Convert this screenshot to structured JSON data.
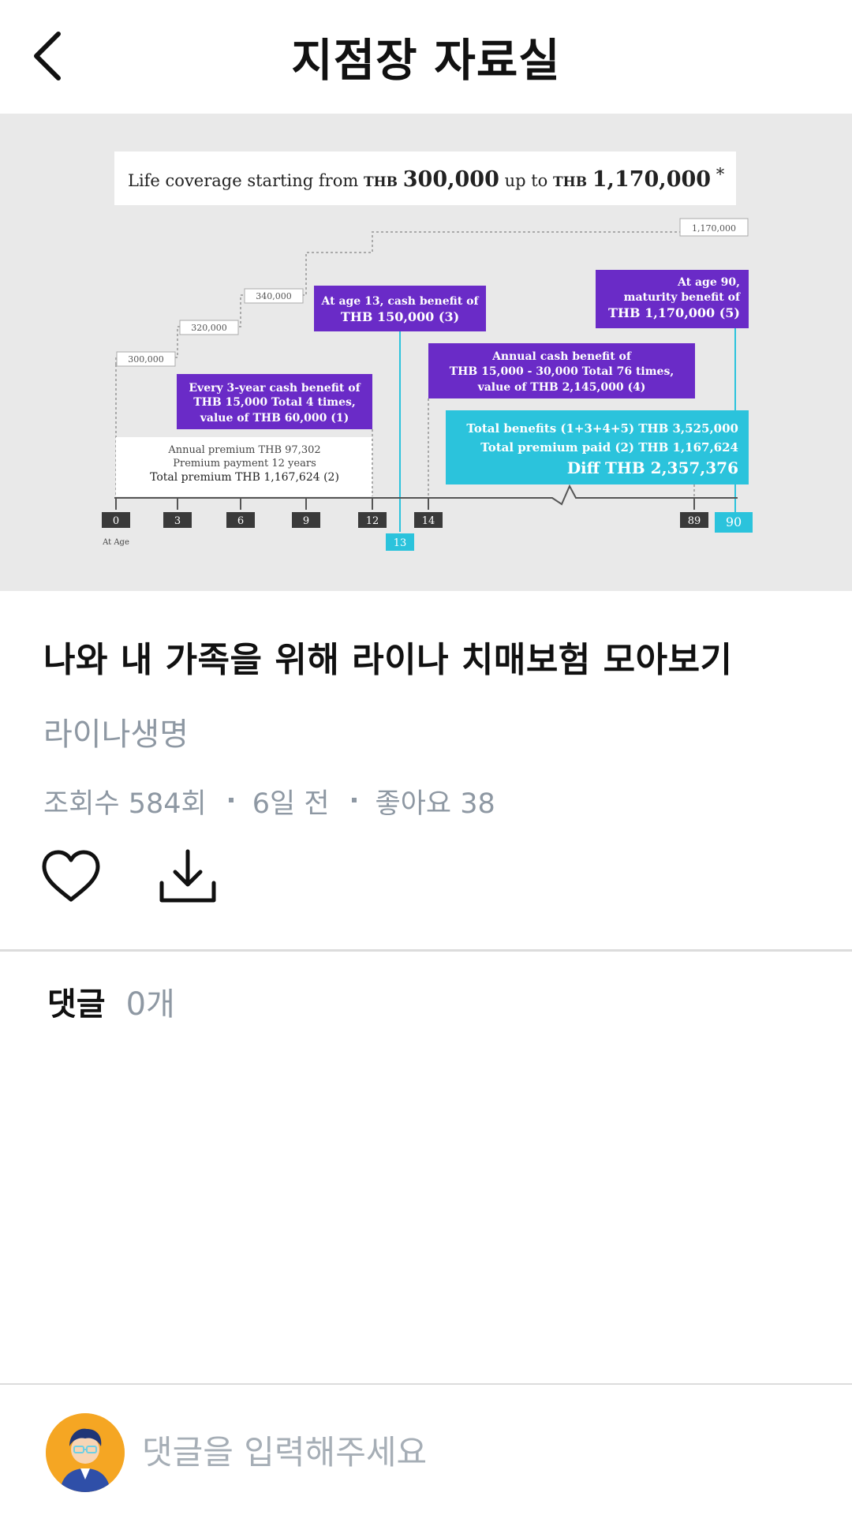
{
  "header": {
    "title": "지점장 자료실"
  },
  "infographic": {
    "headline_prefix": "Life coverage starting from",
    "headline_thb1": "THB",
    "headline_amount1": "300,000",
    "headline_mid": "up to",
    "headline_thb2": "THB",
    "headline_amount2": "1,170,000",
    "headline_mark": "*",
    "coverage_levels": [
      "300,000",
      "320,000",
      "340,000",
      "1,170,000"
    ],
    "box_every3": [
      "Every 3-year cash benefit of",
      "THB 15,000 Total 4 times,",
      "value of THB 60,000 (1)"
    ],
    "box_age13": [
      "At age 13, cash benefit of",
      "THB 150,000 (3)"
    ],
    "box_annual": [
      "Annual cash benefit of",
      "THB 15,000 - 30,000 Total 76 times,",
      "value of THB 2,145,000 (4)"
    ],
    "box_age90": [
      "At age 90,",
      "maturity benefit of",
      "THB 1,170,000 (5)"
    ],
    "premium_lines": [
      "Annual premium THB 97,302",
      "Premium payment 12 years",
      "Total premium THB 1,167,624 (2)"
    ],
    "totals_lines": [
      "Total benefits (1+3+4+5) THB 3,525,000",
      "Total premium paid (2) THB 1,167,624",
      "Diff THB 2,357,376"
    ],
    "ages": [
      "0",
      "3",
      "6",
      "9",
      "12",
      "13",
      "14",
      "89",
      "90"
    ],
    "age_caption": "At Age"
  },
  "post": {
    "title": "나와 내 가족을 위해 라이나 치매보험 모아보기",
    "author": "라이나생명",
    "views": "조회수 584회",
    "date": "6일 전",
    "likes": "좋아요 38"
  },
  "comments": {
    "label": "댓글",
    "count": "0개"
  },
  "comment_input": {
    "placeholder": "댓글을 입력해주세요"
  },
  "colors": {
    "purple": "#6a2bc7",
    "cyan": "#2bc3dc",
    "dark": "#3a3a3a",
    "muted": "#8e98a3"
  },
  "icons": {
    "back": "chevron-left-icon",
    "like": "heart-icon",
    "download": "download-icon"
  }
}
